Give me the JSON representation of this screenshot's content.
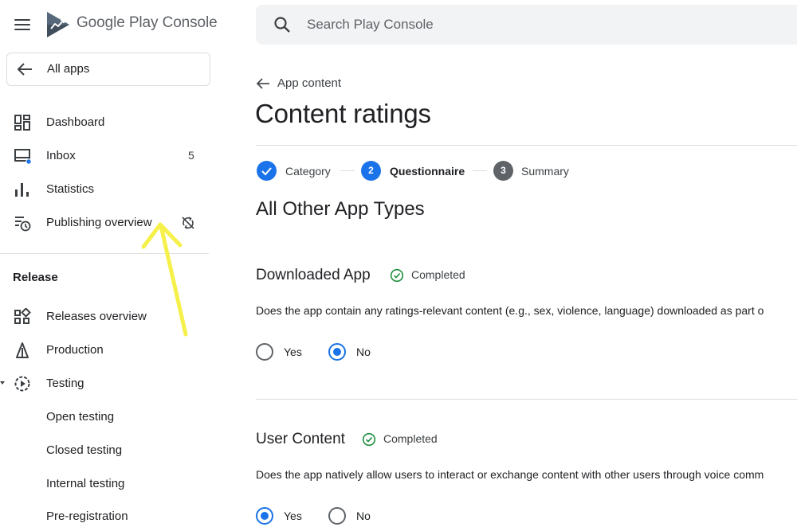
{
  "header": {
    "brand": "Google Play Console",
    "search_placeholder": "Search Play Console"
  },
  "sidebar": {
    "all_apps": "All apps",
    "items": [
      {
        "label": "Dashboard",
        "icon": "dashboard-icon"
      },
      {
        "label": "Inbox",
        "icon": "inbox-icon",
        "count": "5"
      },
      {
        "label": "Statistics",
        "icon": "bar-chart-icon"
      },
      {
        "label": "Publishing overview",
        "icon": "history-icon",
        "trailing_icon": "sync-disabled-icon"
      }
    ],
    "release_section": "Release",
    "release_items": [
      {
        "label": "Releases overview",
        "icon": "grid-icon"
      },
      {
        "label": "Production",
        "icon": "production-icon"
      },
      {
        "label": "Testing",
        "icon": "play-circle-icon"
      },
      {
        "label": "Open testing"
      },
      {
        "label": "Closed testing"
      },
      {
        "label": "Internal testing"
      },
      {
        "label": "Pre-registration"
      }
    ]
  },
  "main": {
    "back_link": "App content",
    "title": "Content ratings",
    "steps": [
      {
        "number": "1",
        "label": "Category",
        "state": "done"
      },
      {
        "number": "2",
        "label": "Questionnaire",
        "state": "active"
      },
      {
        "number": "3",
        "label": "Summary",
        "state": "pending"
      }
    ],
    "section_heading": "All Other App Types",
    "questions": [
      {
        "title": "Downloaded App",
        "status": "Completed",
        "text": "Does the app contain any ratings-relevant content (e.g., sex, violence, language) downloaded as part o",
        "options": [
          "Yes",
          "No"
        ],
        "selected": "No"
      },
      {
        "title": "User Content",
        "status": "Completed",
        "text": "Does the app natively allow users to interact or exchange content with other users through voice comm",
        "options": [
          "Yes",
          "No"
        ],
        "selected": "Yes"
      }
    ]
  },
  "colors": {
    "accent": "#1a73e8",
    "success": "#1e8e3e",
    "step_pending": "#5f6368",
    "annotation": "#f5f04a",
    "logo_dark": "#414e5c",
    "logo_light": "#6c7d8c"
  }
}
